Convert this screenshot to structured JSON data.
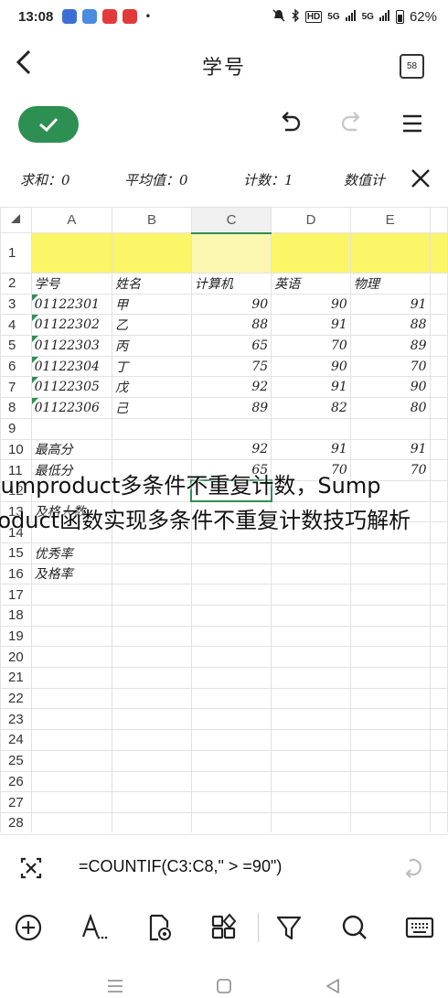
{
  "status_bar": {
    "time": "13:08",
    "dot": "•",
    "hd_label": "HD",
    "signal1": "5G",
    "signal2": "5G",
    "battery": "62%",
    "notification_colors": [
      "#3b6fd6",
      "#4a8be0",
      "#e23a3a",
      "#e23a3a"
    ]
  },
  "title_bar": {
    "back_glyph": "❮",
    "title": "学号",
    "page_count": "58"
  },
  "stats": {
    "sum": "求和：0",
    "average": "平均值：0",
    "count": "计数：1",
    "numeric_count": "数值计"
  },
  "sheet": {
    "columns": [
      "A",
      "B",
      "C",
      "D",
      "E"
    ],
    "selected_column": "C",
    "rows": [
      {
        "n": "1",
        "a": "",
        "b": "",
        "c": "",
        "d": "",
        "e": ""
      },
      {
        "n": "2",
        "a": "学号",
        "b": "姓名",
        "c": "计算机",
        "d": "英语",
        "e": "物理"
      },
      {
        "n": "3",
        "a": "01122301",
        "b": "甲",
        "c": "90",
        "d": "90",
        "e": "91"
      },
      {
        "n": "4",
        "a": "01122302",
        "b": "乙",
        "c": "88",
        "d": "91",
        "e": "88"
      },
      {
        "n": "5",
        "a": "01122303",
        "b": "丙",
        "c": "65",
        "d": "70",
        "e": "89"
      },
      {
        "n": "6",
        "a": "01122304",
        "b": "丁",
        "c": "75",
        "d": "90",
        "e": "70"
      },
      {
        "n": "7",
        "a": "01122305",
        "b": "戊",
        "c": "92",
        "d": "91",
        "e": "90"
      },
      {
        "n": "8",
        "a": "01122306",
        "b": "己",
        "c": "89",
        "d": "82",
        "e": "80"
      },
      {
        "n": "9",
        "a": "",
        "b": "",
        "c": "",
        "d": "",
        "e": ""
      },
      {
        "n": "10",
        "a": "最高分",
        "b": "",
        "c": "92",
        "d": "91",
        "e": "91"
      },
      {
        "n": "11",
        "a": "最低分",
        "b": "",
        "c": "65",
        "d": "70",
        "e": "70"
      },
      {
        "n": "12",
        "a": "",
        "b": "",
        "c": "",
        "d": "",
        "e": ""
      },
      {
        "n": "13",
        "a": "及格人数",
        "b": "",
        "c": "",
        "d": "",
        "e": ""
      },
      {
        "n": "14",
        "a": "",
        "b": "",
        "c": "",
        "d": "",
        "e": ""
      },
      {
        "n": "15",
        "a": "优秀率",
        "b": "",
        "c": "",
        "d": "",
        "e": ""
      },
      {
        "n": "16",
        "a": "及格率",
        "b": "",
        "c": "",
        "d": "",
        "e": ""
      },
      {
        "n": "17",
        "a": "",
        "b": "",
        "c": "",
        "d": "",
        "e": ""
      },
      {
        "n": "18",
        "a": "",
        "b": "",
        "c": "",
        "d": "",
        "e": ""
      },
      {
        "n": "19",
        "a": "",
        "b": "",
        "c": "",
        "d": "",
        "e": ""
      },
      {
        "n": "20",
        "a": "",
        "b": "",
        "c": "",
        "d": "",
        "e": ""
      },
      {
        "n": "21",
        "a": "",
        "b": "",
        "c": "",
        "d": "",
        "e": ""
      },
      {
        "n": "22",
        "a": "",
        "b": "",
        "c": "",
        "d": "",
        "e": ""
      },
      {
        "n": "23",
        "a": "",
        "b": "",
        "c": "",
        "d": "",
        "e": ""
      },
      {
        "n": "24",
        "a": "",
        "b": "",
        "c": "",
        "d": "",
        "e": ""
      },
      {
        "n": "25",
        "a": "",
        "b": "",
        "c": "",
        "d": "",
        "e": ""
      },
      {
        "n": "26",
        "a": "",
        "b": "",
        "c": "",
        "d": "",
        "e": ""
      },
      {
        "n": "27",
        "a": "",
        "b": "",
        "c": "",
        "d": "",
        "e": ""
      },
      {
        "n": "28",
        "a": "",
        "b": "",
        "c": "",
        "d": "",
        "e": ""
      }
    ]
  },
  "caption": {
    "line1": "sumproduct多条件不重复计数，Sump",
    "line2": "roduct函数实现多条件不重复计数技巧解析"
  },
  "formula": {
    "text": "=COUNTIF(C3:C8,\" > =90\")"
  },
  "colors": {
    "accent_green": "#2e8f52",
    "row1_yellow": "#fbf668"
  }
}
